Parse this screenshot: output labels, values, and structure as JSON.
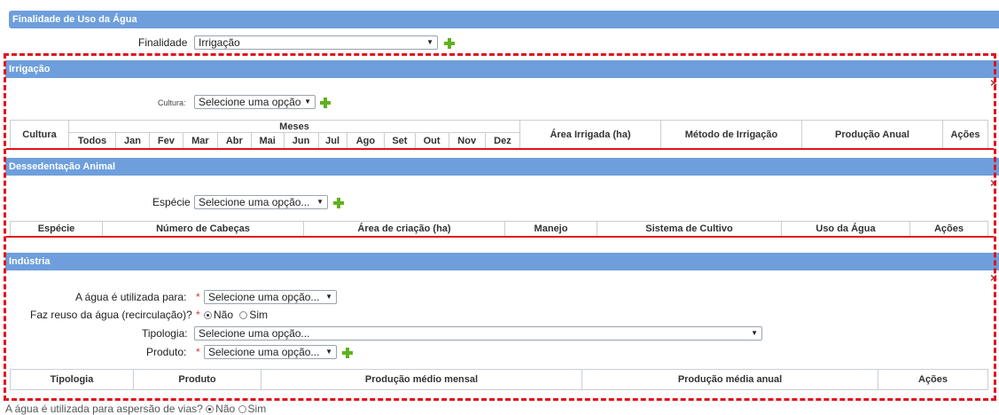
{
  "finalidade_section": {
    "header": "Finalidade de Uso da Água",
    "finalidade_label": "Finalidade",
    "finalidade_value": "Irrigação"
  },
  "irrigacao": {
    "header": "Irrigação",
    "cultura_label": "Cultura:",
    "cultura_value": "Selecione uma opção",
    "table": {
      "cultura": "Cultura",
      "meses": "Meses",
      "months": [
        "Todos",
        "Jan",
        "Fev",
        "Mar",
        "Abr",
        "Mai",
        "Jun",
        "Jul",
        "Ago",
        "Set",
        "Out",
        "Nov",
        "Dez"
      ],
      "area": "Área Irrigada (ha)",
      "metodo": "Método de Irrigação",
      "producao": "Produção Anual",
      "acoes": "Ações"
    }
  },
  "dessedentacao": {
    "header": "Dessedentação Animal",
    "especie_label": "Espécie",
    "especie_value": "Selecione uma opção...",
    "table": {
      "columns": [
        "Espécie",
        "Número de Cabeças",
        "Área de criação (ha)",
        "Manejo",
        "Sistema de Cultivo",
        "Uso da Água",
        "Ações"
      ]
    }
  },
  "industria": {
    "header": "Indústria",
    "agua_utilizada_label": "A água é utilizada para:",
    "agua_utilizada_value": "Selecione uma opção...",
    "reuso_label": "Faz reuso da água (recirculação)?",
    "reuso_nao": "Não",
    "reuso_sim": "Sim",
    "tipologia_label": "Tipologia:",
    "tipologia_value": "Selecione uma opção...",
    "produto_label": "Produto:",
    "produto_value": "Selecione uma opção...",
    "table": {
      "columns": [
        "Tipologia",
        "Produto",
        "Produção médio mensal",
        "Produção média anual",
        "Ações"
      ]
    }
  },
  "aspersao": {
    "label": "A água é utilizada para aspersão de vias?",
    "nao": "Não",
    "sim": "Sim"
  },
  "required_mark": "*",
  "remove_glyph": "×",
  "colors": {
    "header_bar": "#6e9fdc",
    "add_icon": "#5fb21f",
    "remove_icon": "#b53a3a",
    "highlight": "#e0141e"
  }
}
